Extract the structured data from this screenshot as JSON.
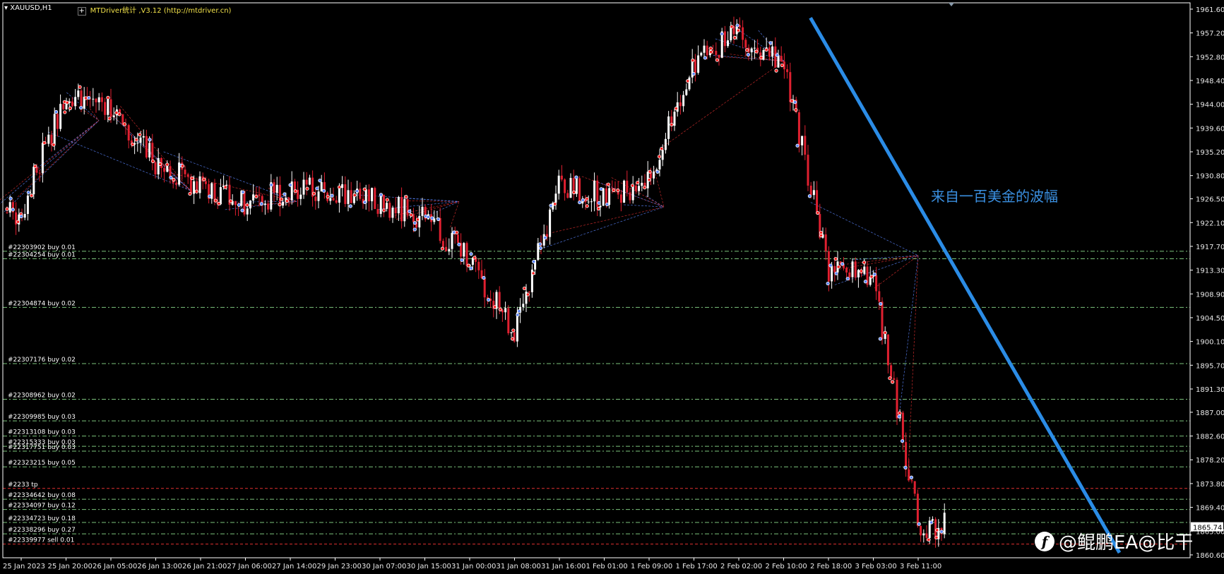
{
  "window": {
    "symbol": "XAUUSD,H1",
    "indicator": "MTDriver统计 ,V3.12 (http://mtdriver.cn)"
  },
  "colors": {
    "background": "#000000",
    "axis": "#ffffff",
    "bull_candle": "#ffffff",
    "bear_candle": "#e02030",
    "buy_line": "#7cc47c",
    "sell_line": "#e03030",
    "trend_line": "#2b8ce6",
    "buy_marker": "#5b86ff",
    "sell_marker": "#ff2020",
    "annotation": "#3a8fe0"
  },
  "annotation_text": "来自一百美金的波幅",
  "watermark": "@鲲鹏EA@比干",
  "current_price": "1865.74",
  "chart_data": {
    "type": "candlestick",
    "title": "XAUUSD,H1",
    "ylim": [
      1860.07,
      1962.77
    ],
    "y_ticks": [
      "1961.60",
      "1957.20",
      "1952.80",
      "1948.40",
      "1944.00",
      "1939.60",
      "1935.20",
      "1930.80",
      "1926.50",
      "1922.10",
      "1917.70",
      "1913.30",
      "1908.90",
      "1904.50",
      "1900.10",
      "1895.70",
      "1891.30",
      "1887.00",
      "1882.60",
      "1878.20",
      "1873.80",
      "1869.40",
      "1865.00",
      "1860.60"
    ],
    "x_ticks": [
      "25 Jan 2023",
      "25 Jan 20:00",
      "26 Jan 05:00",
      "26 Jan 13:00",
      "26 Jan 21:00",
      "27 Jan 06:00",
      "27 Jan 14:00",
      "29 Jan 23:00",
      "30 Jan 07:00",
      "30 Jan 15:00",
      "31 Jan 00:00",
      "31 Jan 08:00",
      "31 Jan 16:00",
      "1 Feb 01:00",
      "1 Feb 09:00",
      "1 Feb 17:00",
      "2 Feb 02:00",
      "2 Feb 10:00",
      "2 Feb 18:00",
      "3 Feb 03:00",
      "3 Feb 11:00"
    ],
    "grid": false,
    "close_series": [
      {
        "label": "25 Jan 2023",
        "value": 1924
      },
      {
        "label": "25 Jan 20:00",
        "value": 1946
      },
      {
        "label": "26 Jan 05:00",
        "value": 1944
      },
      {
        "label": "26 Jan 13:00",
        "value": 1933
      },
      {
        "label": "26 Jan 21:00",
        "value": 1929
      },
      {
        "label": "27 Jan 06:00",
        "value": 1926
      },
      {
        "label": "27 Jan 14:00",
        "value": 1928
      },
      {
        "label": "29 Jan 23:00",
        "value": 1928
      },
      {
        "label": "30 Jan 07:00",
        "value": 1926
      },
      {
        "label": "30 Jan 15:00",
        "value": 1923
      },
      {
        "label": "31 Jan 00:00",
        "value": 1915
      },
      {
        "label": "31 Jan 08:00",
        "value": 1902
      },
      {
        "label": "31 Jan 16:00",
        "value": 1929
      },
      {
        "label": "1 Feb 01:00",
        "value": 1927
      },
      {
        "label": "1 Feb 09:00",
        "value": 1930
      },
      {
        "label": "1 Feb 17:00",
        "value": 1952
      },
      {
        "label": "2 Feb 02:00",
        "value": 1957
      },
      {
        "label": "2 Feb 10:00",
        "value": 1952
      },
      {
        "label": "2 Feb 18:00",
        "value": 1913
      },
      {
        "label": "3 Feb 03:00",
        "value": 1912
      },
      {
        "label": "3 Feb 11:00",
        "value": 1866
      }
    ],
    "order_lines": [
      {
        "label": "#22303902 buy 0.01",
        "price": 1916.8,
        "type": "buy"
      },
      {
        "label": "#22304254 buy 0.01",
        "price": 1915.4,
        "type": "buy"
      },
      {
        "label": "#22304874 buy 0.02",
        "price": 1906.4,
        "type": "buy"
      },
      {
        "label": "#22307176 buy 0.02",
        "price": 1896.0,
        "type": "buy"
      },
      {
        "label": "#22308962 buy 0.02",
        "price": 1889.4,
        "type": "buy"
      },
      {
        "label": "#22309985 buy 0.03",
        "price": 1885.4,
        "type": "buy"
      },
      {
        "label": "#22313108 buy 0.03",
        "price": 1882.6,
        "type": "buy"
      },
      {
        "label": "#22315333 buy 0.03",
        "price": 1880.7,
        "type": "buy"
      },
      {
        "label": "#22317751 buy 0.03",
        "price": 1879.8,
        "type": "buy"
      },
      {
        "label": "#22323215 buy 0.05",
        "price": 1876.9,
        "type": "buy"
      },
      {
        "label": "#22334642 buy 0.08",
        "price": 1870.9,
        "type": "buy"
      },
      {
        "label": "#22334097 buy 0.12",
        "price": 1869.0,
        "type": "buy"
      },
      {
        "label": "#22334723 buy 0.18",
        "price": 1866.6,
        "type": "buy"
      },
      {
        "label": "#22338296 buy 0.27",
        "price": 1864.5,
        "type": "buy"
      },
      {
        "label": "#2233 tp",
        "price": 1872.9,
        "type": "tp"
      },
      {
        "label": "#22339977 sell 0.01",
        "price": 1862.6,
        "type": "sell"
      }
    ],
    "trend_line": {
      "from": {
        "x": "2 Feb 10:00",
        "y": 1960
      },
      "to": {
        "x": "3 Feb 11:00",
        "y": 1861
      }
    }
  }
}
